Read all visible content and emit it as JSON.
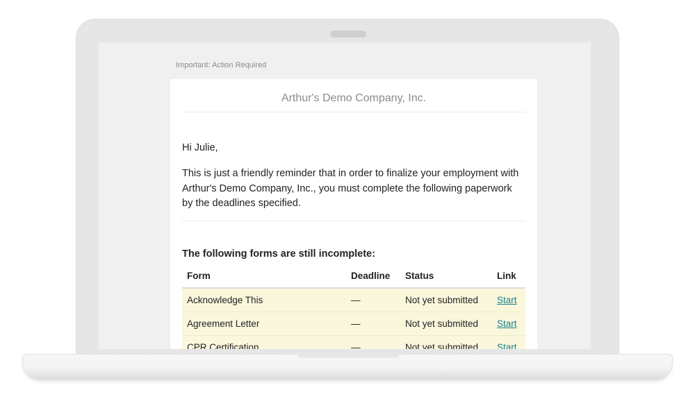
{
  "email": {
    "preheader": "Important: Action Required",
    "company_name": "Arthur's Demo Company, Inc.",
    "greeting": "Hi Julie,",
    "message": "This is just a friendly reminder that in order to finalize your employment with Arthur's Demo Company, Inc., you must complete the following paperwork by the deadlines specified.",
    "forms_heading": "The following forms are still incomplete:",
    "table": {
      "headers": {
        "form": "Form",
        "deadline": "Deadline",
        "status": "Status",
        "link": "Link"
      },
      "rows": [
        {
          "form": "Acknowledge This",
          "deadline": "—",
          "status": "Not yet submitted",
          "link": "Start"
        },
        {
          "form": "Agreement Letter",
          "deadline": "—",
          "status": "Not yet submitted",
          "link": "Start"
        },
        {
          "form": "CPR Certification",
          "deadline": "—",
          "status": "Not yet submitted",
          "link": "Start"
        }
      ]
    }
  },
  "colors": {
    "row_highlight": "#faf7dc",
    "link": "#1a7d8a",
    "device_frame": "#e6e6e6"
  }
}
